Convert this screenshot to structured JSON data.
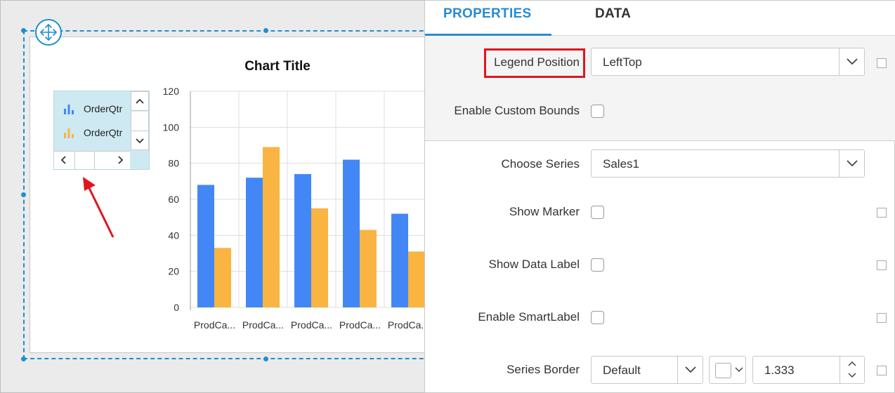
{
  "chart": {
    "title": "Chart Title",
    "legend": {
      "items": [
        {
          "label": "OrderQtr",
          "color": "#4287f5"
        },
        {
          "label": "OrderQtr",
          "color": "#f9b442"
        }
      ]
    }
  },
  "chart_data": {
    "type": "bar",
    "title": "Chart Title",
    "categories": [
      "ProdCa...",
      "ProdCa...",
      "ProdCa...",
      "ProdCa...",
      "ProdCa..."
    ],
    "series": [
      {
        "name": "OrderQtr",
        "color": "#4287f5",
        "values": [
          68,
          72,
          74,
          82,
          52
        ]
      },
      {
        "name": "OrderQtr",
        "color": "#f9b442",
        "values": [
          33,
          89,
          55,
          43,
          31
        ]
      }
    ],
    "ylim": [
      0,
      120
    ],
    "yticks": [
      0,
      20,
      40,
      60,
      80,
      100,
      120
    ],
    "grid": true,
    "legend_position": "left-top"
  },
  "panel": {
    "tabs": [
      {
        "label": "PROPERTIES",
        "active": true
      },
      {
        "label": "DATA",
        "active": false
      }
    ],
    "legend_position": {
      "label": "Legend Position",
      "value": "LeftTop"
    },
    "enable_custom_bounds": {
      "label": "Enable Custom Bounds",
      "checked": false
    },
    "choose_series": {
      "label": "Choose Series",
      "value": "Sales1"
    },
    "show_marker": {
      "label": "Show Marker",
      "checked": false
    },
    "show_data_label": {
      "label": "Show Data Label",
      "checked": false
    },
    "enable_smart_label": {
      "label": "Enable SmartLabel",
      "checked": false
    },
    "series_border": {
      "label": "Series Border",
      "style": "Default",
      "width": "1.333"
    }
  },
  "colors": {
    "accent": "#2a8ad4",
    "selection": "#1e8fd0",
    "highlight": "#e0161d",
    "legend_bg": "#cfe9f3"
  }
}
